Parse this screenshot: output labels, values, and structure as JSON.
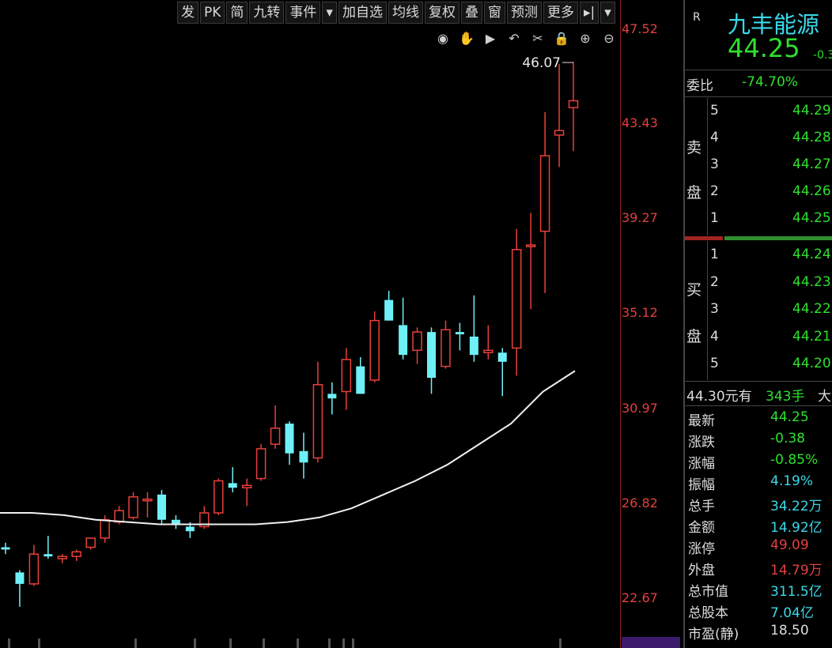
{
  "toolbar": [
    "发",
    "PK",
    "简",
    "九转",
    "事件",
    "▾",
    "加自选",
    "均线",
    "复权",
    "叠",
    "窗",
    "预测",
    "更多",
    "▸|",
    "▾"
  ],
  "tools": [
    {
      "name": "eye-icon",
      "glyph": "◉"
    },
    {
      "name": "hand-icon",
      "glyph": "✋"
    },
    {
      "name": "play-icon",
      "glyph": "▶"
    },
    {
      "name": "undo-icon",
      "glyph": "↶"
    },
    {
      "name": "scissors-icon",
      "glyph": "✂"
    },
    {
      "name": "lock-icon",
      "glyph": "🔒"
    },
    {
      "name": "zoom-in-icon",
      "glyph": "⊕"
    },
    {
      "name": "zoom-out-icon",
      "glyph": "⊖"
    }
  ],
  "chart_data": {
    "type": "candlestick",
    "y_ticks": [
      "47.52",
      "43.43",
      "39.27",
      "35.12",
      "30.97",
      "26.82",
      "22.67"
    ],
    "ylim": [
      20.5,
      48.8
    ],
    "max_marker": "46.07",
    "candles": [
      {
        "o": 24.9,
        "h": 25.1,
        "l": 24.6,
        "c": 24.8
      },
      {
        "o": 23.8,
        "h": 23.9,
        "l": 22.3,
        "c": 23.3
      },
      {
        "o": 23.3,
        "h": 25.0,
        "l": 23.2,
        "c": 24.6
      },
      {
        "o": 24.6,
        "h": 25.4,
        "l": 24.4,
        "c": 24.5
      },
      {
        "o": 24.4,
        "h": 24.6,
        "l": 24.2,
        "c": 24.5
      },
      {
        "o": 24.5,
        "h": 24.8,
        "l": 24.3,
        "c": 24.7
      },
      {
        "o": 24.9,
        "h": 25.2,
        "l": 24.8,
        "c": 25.3
      },
      {
        "o": 25.3,
        "h": 26.3,
        "l": 25.1,
        "c": 26.1
      },
      {
        "o": 26.0,
        "h": 26.7,
        "l": 25.9,
        "c": 26.5
      },
      {
        "o": 26.2,
        "h": 27.3,
        "l": 26.1,
        "c": 27.1
      },
      {
        "o": 27.0,
        "h": 27.3,
        "l": 26.2,
        "c": 27.0
      },
      {
        "o": 27.2,
        "h": 27.4,
        "l": 25.9,
        "c": 26.1
      },
      {
        "o": 26.1,
        "h": 26.3,
        "l": 25.7,
        "c": 25.9
      },
      {
        "o": 25.8,
        "h": 26.0,
        "l": 25.3,
        "c": 25.6
      },
      {
        "o": 25.8,
        "h": 26.7,
        "l": 25.7,
        "c": 26.4
      },
      {
        "o": 26.4,
        "h": 27.9,
        "l": 26.3,
        "c": 27.8
      },
      {
        "o": 27.7,
        "h": 28.4,
        "l": 27.3,
        "c": 27.5
      },
      {
        "o": 27.5,
        "h": 27.9,
        "l": 26.7,
        "c": 27.6
      },
      {
        "o": 27.9,
        "h": 29.4,
        "l": 27.8,
        "c": 29.2
      },
      {
        "o": 29.4,
        "h": 31.1,
        "l": 29.2,
        "c": 30.1
      },
      {
        "o": 30.3,
        "h": 30.4,
        "l": 28.5,
        "c": 29.0
      },
      {
        "o": 29.1,
        "h": 29.9,
        "l": 27.9,
        "c": 28.6
      },
      {
        "o": 28.8,
        "h": 33.0,
        "l": 28.6,
        "c": 32.0
      },
      {
        "o": 31.6,
        "h": 32.1,
        "l": 30.7,
        "c": 31.4
      },
      {
        "o": 31.7,
        "h": 33.6,
        "l": 30.9,
        "c": 33.1
      },
      {
        "o": 32.8,
        "h": 33.2,
        "l": 31.6,
        "c": 31.6
      },
      {
        "o": 32.2,
        "h": 35.2,
        "l": 32.1,
        "c": 34.8
      },
      {
        "o": 35.7,
        "h": 36.1,
        "l": 34.8,
        "c": 34.8
      },
      {
        "o": 34.6,
        "h": 35.8,
        "l": 33.1,
        "c": 33.3
      },
      {
        "o": 33.5,
        "h": 34.5,
        "l": 32.9,
        "c": 34.3
      },
      {
        "o": 34.3,
        "h": 34.5,
        "l": 31.6,
        "c": 32.3
      },
      {
        "o": 32.8,
        "h": 34.8,
        "l": 32.7,
        "c": 34.4
      },
      {
        "o": 34.3,
        "h": 34.7,
        "l": 33.5,
        "c": 34.2
      },
      {
        "o": 34.1,
        "h": 35.9,
        "l": 33.0,
        "c": 33.3
      },
      {
        "o": 33.4,
        "h": 34.6,
        "l": 33.1,
        "c": 33.5
      },
      {
        "o": 33.4,
        "h": 33.6,
        "l": 31.5,
        "c": 33.0
      },
      {
        "o": 33.6,
        "h": 38.8,
        "l": 32.4,
        "c": 37.9
      },
      {
        "o": 38.1,
        "h": 39.5,
        "l": 35.3,
        "c": 38.1
      },
      {
        "o": 38.7,
        "h": 43.9,
        "l": 36.0,
        "c": 42.0
      },
      {
        "o": 42.9,
        "h": 46.0,
        "l": 41.5,
        "c": 43.1
      },
      {
        "o": 44.1,
        "h": 46.1,
        "l": 42.2,
        "c": 44.4
      }
    ],
    "ma_line": [
      26.4,
      26.4,
      26.3,
      26.1,
      26.0,
      25.9,
      25.9,
      25.9,
      25.9,
      26.0,
      26.2,
      26.6,
      27.2,
      27.8,
      28.5,
      29.4,
      30.3,
      31.7,
      32.6
    ]
  },
  "panel": {
    "r_badge": "R",
    "stock_name": "九丰能源",
    "price": "44.25",
    "change": "-0.3",
    "weibi_label": "委比",
    "weibi_value": "-74.70%",
    "sell_label": [
      "卖",
      "盘"
    ],
    "buy_label": [
      "买",
      "盘"
    ],
    "asks": [
      {
        "n": "5",
        "price": "44.29"
      },
      {
        "n": "4",
        "price": "44.28"
      },
      {
        "n": "3",
        "price": "44.27"
      },
      {
        "n": "2",
        "price": "44.26"
      },
      {
        "n": "1",
        "price": "44.25"
      }
    ],
    "bids": [
      {
        "n": "1",
        "price": "44.24"
      },
      {
        "n": "2",
        "price": "44.23"
      },
      {
        "n": "3",
        "price": "44.22"
      },
      {
        "n": "4",
        "price": "44.21"
      },
      {
        "n": "5",
        "price": "44.20"
      }
    ],
    "trade_price": "44.30元有",
    "trade_volume": "343手",
    "trade_tag": "大",
    "quotes": [
      {
        "label": "最新",
        "value": "44.25",
        "color": "#2ee02e"
      },
      {
        "label": "涨跌",
        "value": "-0.38",
        "color": "#2ee02e"
      },
      {
        "label": "涨幅",
        "value": "-0.85%",
        "color": "#2ee02e"
      },
      {
        "label": "振幅",
        "value": "4.19%",
        "color": "#3ad8e8"
      },
      {
        "label": "总手",
        "value": "34.22万",
        "color": "#3ad8e8"
      },
      {
        "label": "金额",
        "value": "14.92亿",
        "color": "#3ad8e8"
      },
      {
        "label": "涨停",
        "value": "49.09",
        "color": "#e24040"
      },
      {
        "label": "外盘",
        "value": "14.79万",
        "color": "#e24040"
      },
      {
        "label": "总市值",
        "value": "311.5亿",
        "color": "#3ad8e8"
      },
      {
        "label": "总股本",
        "value": "7.04亿",
        "color": "#3ad8e8"
      },
      {
        "label": "市盈(静)",
        "value": "18.50",
        "color": "#ddd"
      }
    ]
  }
}
